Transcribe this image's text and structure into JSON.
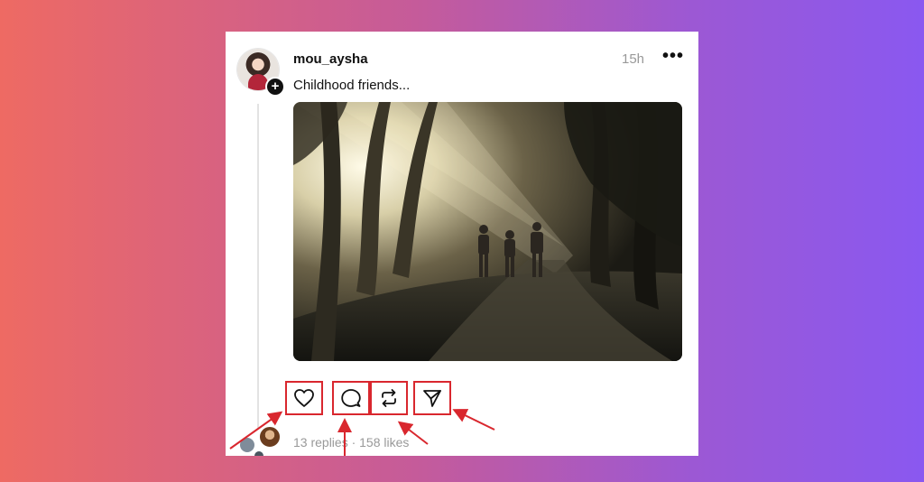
{
  "post": {
    "username": "mou_aysha",
    "time": "15h",
    "caption": "Childhood friends...",
    "more_label": "•••",
    "add_label": "+"
  },
  "actions": {
    "like_icon": "heart-icon",
    "comment_icon": "comment-icon",
    "repost_icon": "repost-icon",
    "share_icon": "send-icon",
    "highlight_color": "#d9272e"
  },
  "stats": {
    "text": "13 replies · 158 likes"
  },
  "colors": {
    "gradient_start": "#ee6a63",
    "gradient_end": "#8a58f0",
    "annotation_red": "#d9272e"
  }
}
